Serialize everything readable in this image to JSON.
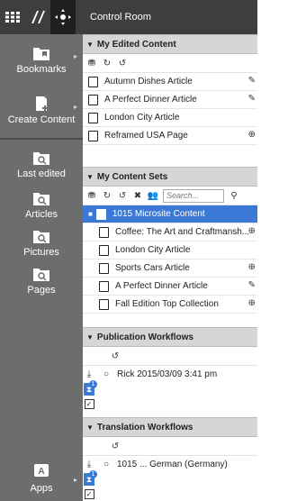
{
  "topbar": {
    "grid_icon": "grid-icon",
    "logo_icon": "app-logo-icon",
    "move_icon": "move-icon"
  },
  "sidebar": {
    "items": [
      {
        "name": "bookmarks",
        "label": "Bookmarks",
        "has_arrow": true
      },
      {
        "name": "create-content",
        "label": "Create Content",
        "has_arrow": true
      },
      {
        "name": "last-edited",
        "label": "Last edited",
        "has_arrow": false
      },
      {
        "name": "articles",
        "label": "Articles",
        "has_arrow": false
      },
      {
        "name": "pictures",
        "label": "Pictures",
        "has_arrow": false
      },
      {
        "name": "pages",
        "label": "Pages",
        "has_arrow": false
      }
    ],
    "apps_label": "Apps"
  },
  "main": {
    "title": "Control Room",
    "edited": {
      "title": "My Edited Content",
      "items": [
        {
          "label": "Autumn Dishes Article",
          "right": "✎"
        },
        {
          "label": "A Perfect Dinner Article",
          "right": "✎"
        },
        {
          "label": "London City Article",
          "right": ""
        },
        {
          "label": "Reframed USA Page",
          "right": "⊕"
        }
      ]
    },
    "sets": {
      "title": "My Content Sets",
      "search_placeholder": "Search...",
      "selected": "1015 Microsite Content",
      "items": [
        {
          "label": "Coffee: The Art and Craftmansh...",
          "right": "⊕"
        },
        {
          "label": "London City Article",
          "right": ""
        },
        {
          "label": "Sports Cars Article",
          "right": "⊕"
        },
        {
          "label": "A Perfect Dinner Article",
          "right": "✎"
        },
        {
          "label": "Fall Edition Top Collection",
          "right": "⊕"
        }
      ]
    },
    "publication": {
      "title": "Publication Workflows",
      "entry": "Rick 2015/03/09 3:41 pm",
      "badge": "1"
    },
    "translation": {
      "title": "Translation Workflows",
      "entry": "1015 ...  German (Germany)",
      "badge": "1"
    }
  }
}
